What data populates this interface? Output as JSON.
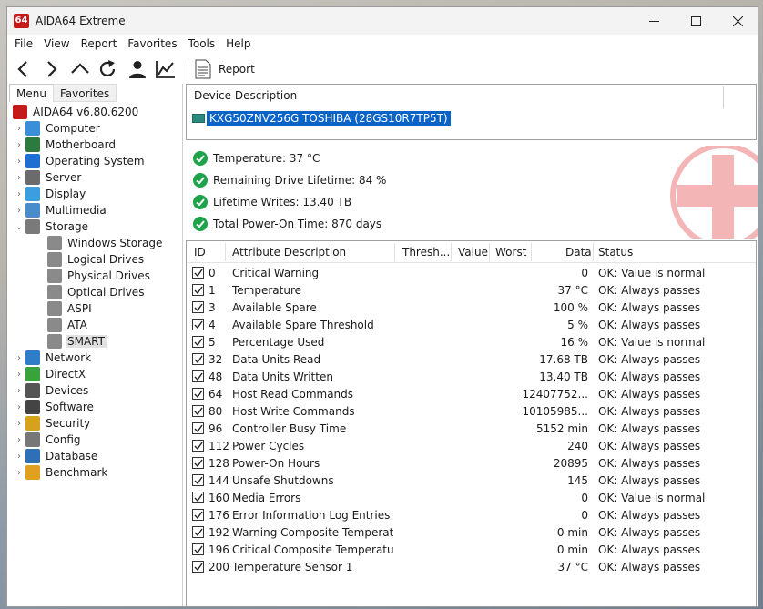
{
  "window": {
    "logo_text": "64",
    "title": "AIDA64 Extreme"
  },
  "menubar": [
    "File",
    "View",
    "Report",
    "Favorites",
    "Tools",
    "Help"
  ],
  "toolbar": {
    "report_label": "Report"
  },
  "tabs": {
    "menu": "Menu",
    "favorites": "Favorites"
  },
  "tree": {
    "root": "AIDA64 v6.80.6200",
    "items": [
      {
        "label": "Computer",
        "icon": "computer-icon",
        "color": "#3a8fd8"
      },
      {
        "label": "Motherboard",
        "icon": "motherboard-icon",
        "color": "#2c7a3d"
      },
      {
        "label": "Operating System",
        "icon": "windows-icon",
        "color": "#1e6fd1"
      },
      {
        "label": "Server",
        "icon": "server-icon",
        "color": "#6b6b6b"
      },
      {
        "label": "Display",
        "icon": "display-icon",
        "color": "#3a9ee0"
      },
      {
        "label": "Multimedia",
        "icon": "multimedia-icon",
        "color": "#4a8bc9"
      },
      {
        "label": "Storage",
        "icon": "storage-icon",
        "color": "#7a7a7a"
      }
    ],
    "storage_children": [
      {
        "label": "Windows Storage",
        "icon": "drive-icon"
      },
      {
        "label": "Logical Drives",
        "icon": "drive-icon"
      },
      {
        "label": "Physical Drives",
        "icon": "drive-icon"
      },
      {
        "label": "Optical Drives",
        "icon": "optical-drive-icon"
      },
      {
        "label": "ASPI",
        "icon": "aspi-icon"
      },
      {
        "label": "ATA",
        "icon": "ata-icon"
      },
      {
        "label": "SMART",
        "icon": "smart-icon"
      }
    ],
    "items_after": [
      {
        "label": "Network",
        "icon": "network-icon",
        "color": "#2f7cc9"
      },
      {
        "label": "DirectX",
        "icon": "directx-icon",
        "color": "#3aa23a"
      },
      {
        "label": "Devices",
        "icon": "devices-icon",
        "color": "#555555"
      },
      {
        "label": "Software",
        "icon": "software-icon",
        "color": "#444444"
      },
      {
        "label": "Security",
        "icon": "security-icon",
        "color": "#d6a21e"
      },
      {
        "label": "Config",
        "icon": "config-icon",
        "color": "#777777"
      },
      {
        "label": "Database",
        "icon": "database-icon",
        "color": "#2f6fb5"
      },
      {
        "label": "Benchmark",
        "icon": "benchmark-icon",
        "color": "#e0a020"
      }
    ]
  },
  "device": {
    "header": "Device Description",
    "name": "KXG50ZNV256G TOSHIBA (28GS10R7TP5T)"
  },
  "status": [
    "Temperature: 37 °C",
    "Remaining Drive Lifetime: 84 %",
    "Lifetime Writes: 13.40 TB",
    "Total Power-On Time: 870 days"
  ],
  "table": {
    "headers": {
      "id": "ID",
      "desc": "Attribute Description",
      "thresh": "Thresh...",
      "value": "Value",
      "worst": "Worst",
      "data": "Data",
      "status": "Status"
    },
    "rows": [
      {
        "id": "0",
        "desc": "Critical Warning",
        "data": "0",
        "status": "OK: Value is normal"
      },
      {
        "id": "1",
        "desc": "Temperature",
        "data": "37 °C",
        "status": "OK: Always passes"
      },
      {
        "id": "3",
        "desc": "Available Spare",
        "data": "100 %",
        "status": "OK: Always passes"
      },
      {
        "id": "4",
        "desc": "Available Spare Threshold",
        "data": "5 %",
        "status": "OK: Always passes"
      },
      {
        "id": "5",
        "desc": "Percentage Used",
        "data": "16 %",
        "status": "OK: Value is normal"
      },
      {
        "id": "32",
        "desc": "Data Units Read",
        "data": "17.68 TB",
        "status": "OK: Always passes"
      },
      {
        "id": "48",
        "desc": "Data Units Written",
        "data": "13.40 TB",
        "status": "OK: Always passes"
      },
      {
        "id": "64",
        "desc": "Host Read Commands",
        "data": "12407752...",
        "status": "OK: Always passes"
      },
      {
        "id": "80",
        "desc": "Host Write Commands",
        "data": "10105985...",
        "status": "OK: Always passes"
      },
      {
        "id": "96",
        "desc": "Controller Busy Time",
        "data": "5152 min",
        "status": "OK: Always passes"
      },
      {
        "id": "112",
        "desc": "Power Cycles",
        "data": "240",
        "status": "OK: Always passes"
      },
      {
        "id": "128",
        "desc": "Power-On Hours",
        "data": "20895",
        "status": "OK: Always passes"
      },
      {
        "id": "144",
        "desc": "Unsafe Shutdowns",
        "data": "145",
        "status": "OK: Always passes"
      },
      {
        "id": "160",
        "desc": "Media Errors",
        "data": "0",
        "status": "OK: Value is normal"
      },
      {
        "id": "176",
        "desc": "Error Information Log Entries",
        "data": "0",
        "status": "OK: Always passes"
      },
      {
        "id": "192",
        "desc": "Warning Composite Temperat...",
        "data": "0 min",
        "status": "OK: Always passes"
      },
      {
        "id": "196",
        "desc": "Critical Composite Temperatur...",
        "data": "0 min",
        "status": "OK: Always passes"
      },
      {
        "id": "200",
        "desc": "Temperature Sensor 1",
        "data": "37 °C",
        "status": "OK: Always passes"
      }
    ]
  },
  "colors": {
    "selection": "#0a64c8",
    "ok_green": "#1fa34a",
    "logo_red": "#c61a1a"
  }
}
